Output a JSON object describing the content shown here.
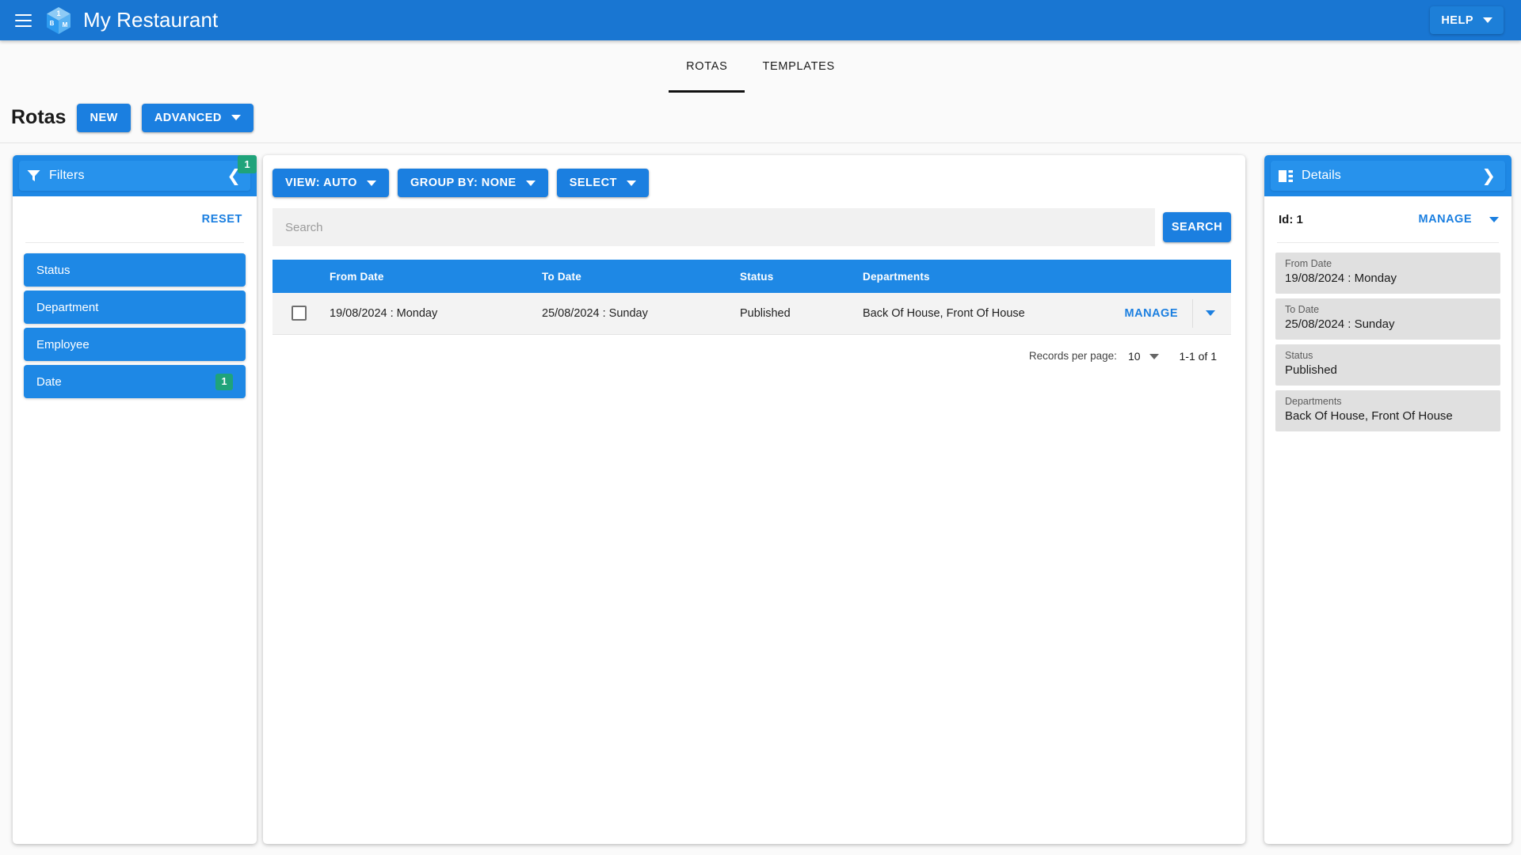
{
  "appbar": {
    "menu_icon": "hamburger-menu-icon",
    "logo_icon": "cube-logo-icon",
    "logo_faces": {
      "top": "1",
      "left": "B",
      "right": "M"
    },
    "title": "My Restaurant",
    "help_label": "HELP",
    "bg_color": "#1976d2"
  },
  "tabs": [
    {
      "label": "ROTAS",
      "active": true
    },
    {
      "label": "TEMPLATES",
      "active": false
    }
  ],
  "pagehead": {
    "title": "Rotas",
    "new_label": "NEW",
    "advanced_label": "ADVANCED"
  },
  "filters": {
    "header_label": "Filters",
    "header_icon": "filter-funnel-icon",
    "collapse_icon": "chevron-left-icon",
    "badge": "1",
    "reset_label": "RESET",
    "items": [
      {
        "label": "Status",
        "badge": ""
      },
      {
        "label": "Department",
        "badge": ""
      },
      {
        "label": "Employee",
        "badge": ""
      },
      {
        "label": "Date",
        "badge": "1"
      }
    ]
  },
  "toolbar": {
    "view_label": "VIEW: AUTO",
    "group_by_label": "GROUP BY: NONE",
    "select_label": "SELECT"
  },
  "search": {
    "value": "",
    "placeholder": "Search",
    "button_label": "SEARCH"
  },
  "table": {
    "columns": [
      "",
      "From Date",
      "To Date",
      "Status",
      "Departments",
      ""
    ],
    "rows": [
      {
        "checked": false,
        "from_date": "19/08/2024 : Monday",
        "to_date": "25/08/2024 : Sunday",
        "status": "Published",
        "departments": "Back Of House, Front Of House",
        "action_label": "MANAGE"
      }
    ]
  },
  "pagination": {
    "records_label": "Records per page:",
    "records_value": "10",
    "range": "1-1 of 1"
  },
  "details": {
    "header_label": "Details",
    "header_icon": "details-panel-icon",
    "expand_icon": "chevron-right-icon",
    "id_label": "Id: 1",
    "manage_label": "MANAGE",
    "fields": [
      {
        "key": "From Date",
        "value": "19/08/2024 : Monday"
      },
      {
        "key": "To Date",
        "value": "25/08/2024 : Sunday"
      },
      {
        "key": "Status",
        "value": "Published"
      },
      {
        "key": "Departments",
        "value": "Back Of House, Front Of House"
      }
    ]
  },
  "colors": {
    "primary": "#1976d2",
    "accent_blue": "#1e88e5",
    "link_blue": "#1b7fe0",
    "badge_green": "#1fa37a",
    "page_bg": "#fafafa"
  }
}
